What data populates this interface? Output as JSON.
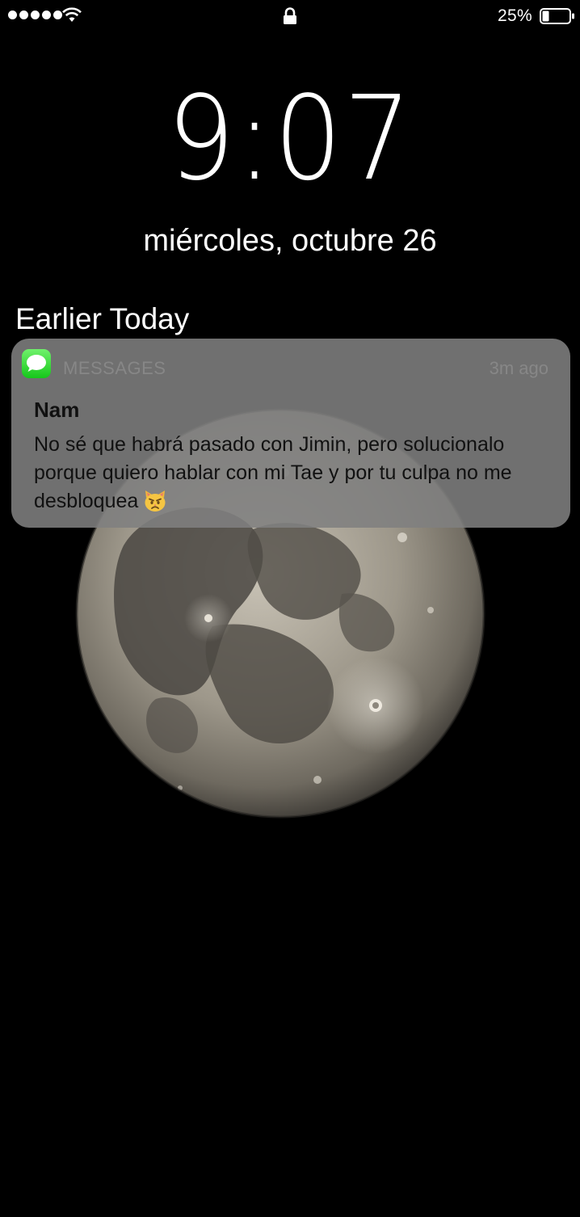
{
  "status_bar": {
    "signal_bars": 5,
    "wifi_icon": "wifi-icon",
    "lock_icon": "lock-icon",
    "battery_percent": "25%",
    "battery_level": 0.25
  },
  "lock_screen": {
    "time": "9:07",
    "date": "miércoles, octubre 26"
  },
  "notifications": {
    "section_title": "Earlier Today",
    "items": [
      {
        "app_name": "MESSAGES",
        "app_icon": "messages-app-icon",
        "time_ago": "3m ago",
        "sender": "Nam",
        "message": "No sé que habrá pasado con Jimin, pero solucionalo porque quiero hablar con mi Tae y por tu culpa no me desbloquea",
        "emoji_icon": "pouting-cat-emoji",
        "app_color": "#34c759"
      }
    ]
  },
  "wallpaper": {
    "subject": "full-moon-wallpaper",
    "background_color": "#000000"
  }
}
